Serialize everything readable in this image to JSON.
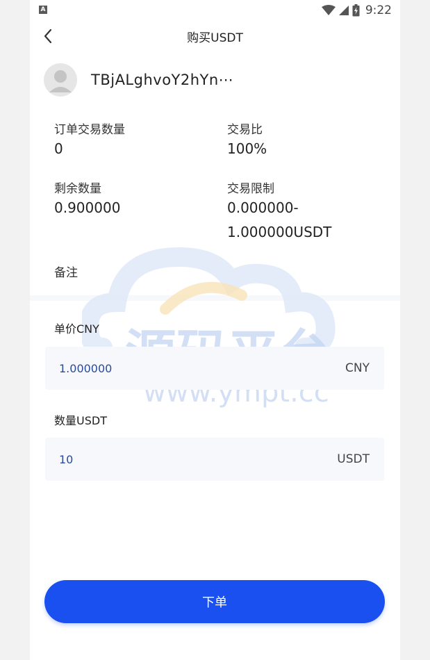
{
  "status_bar": {
    "notification_badge": "A",
    "time": "9:22"
  },
  "header": {
    "title": "购买USDT"
  },
  "user": {
    "name": "TBjALghvoY2hYn⋯"
  },
  "info": {
    "order_count_label": "订单交易数量",
    "order_count_value": "0",
    "trade_ratio_label": "交易比",
    "trade_ratio_value": "100%",
    "remaining_label": "剩余数量",
    "remaining_value": "0.900000",
    "limit_label": "交易限制",
    "limit_value_line1": "0.000000-",
    "limit_value_line2": "1.000000USDT",
    "remark_label": "备注"
  },
  "watermark": {
    "title": "源码平台",
    "url": "www.ympt.cc"
  },
  "form": {
    "price_label": "单价CNY",
    "price_value": "1.000000",
    "price_unit": "CNY",
    "quantity_label": "数量USDT",
    "quantity_value": "10",
    "quantity_unit": "USDT"
  },
  "actions": {
    "submit_label": "下单"
  },
  "colors": {
    "primary": "#1a4ff0",
    "input_text": "#2b4a9a",
    "field_bg": "#f6f8fc"
  }
}
